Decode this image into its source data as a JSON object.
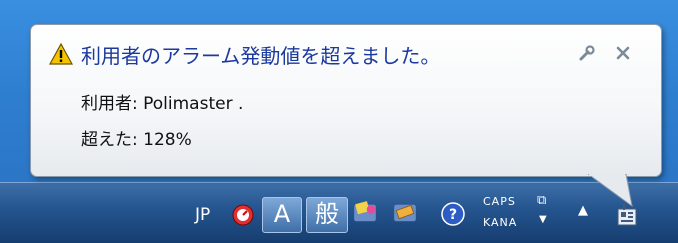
{
  "notification": {
    "title": "利用者のアラーム発動値を超えました。",
    "user_line": "利用者: Polimaster .",
    "exceeded_line": "超えた: 128%",
    "icon": "warning-icon",
    "settings_icon": "wrench-icon",
    "close_icon": "close-icon"
  },
  "tray": {
    "language": "JP",
    "ime_mode_char": "A",
    "ime_kanji_char": "般",
    "caps_label": "CAPS",
    "kana_label": "KANA",
    "icons": [
      "red-stopwatch-icon",
      "ime-pad-icon",
      "ime-tools-icon",
      "help-icon",
      "show-hidden-icons-arrow",
      "device-icon"
    ]
  },
  "colors": {
    "title": "#1c3a9e",
    "taskbar": "#24548e",
    "desktop": "#2e7ed0"
  }
}
